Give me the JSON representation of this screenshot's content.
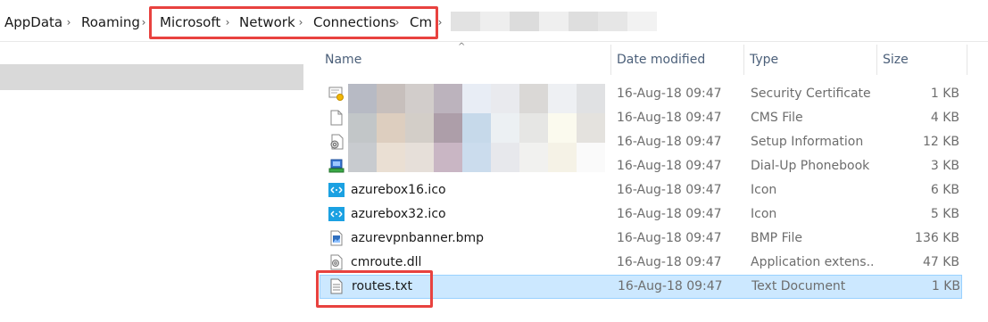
{
  "breadcrumb": {
    "items": [
      "AppData",
      "Roaming",
      "Microsoft",
      "Network",
      "Connections",
      "Cm"
    ]
  },
  "columns": {
    "name": "Name",
    "date": "Date modified",
    "type": "Type",
    "size": "Size"
  },
  "files": [
    {
      "name": "",
      "date": "16-Aug-18 09:47",
      "type": "Security Certificate",
      "size": "1 KB",
      "icon": "certificate-icon"
    },
    {
      "name": "",
      "date": "16-Aug-18 09:47",
      "type": "CMS File",
      "size": "4 KB",
      "icon": "blank-file-icon"
    },
    {
      "name": "",
      "date": "16-Aug-18 09:47",
      "type": "Setup Information",
      "size": "12 KB",
      "icon": "setup-info-icon"
    },
    {
      "name": "",
      "date": "16-Aug-18 09:47",
      "type": "Dial-Up Phonebook",
      "size": "3 KB",
      "icon": "phonebook-icon"
    },
    {
      "name": "azurebox16.ico",
      "date": "16-Aug-18 09:47",
      "type": "Icon",
      "size": "6 KB",
      "icon": "azure-ico-icon"
    },
    {
      "name": "azurebox32.ico",
      "date": "16-Aug-18 09:47",
      "type": "Icon",
      "size": "5 KB",
      "icon": "azure-ico-icon"
    },
    {
      "name": "azurevpnbanner.bmp",
      "date": "16-Aug-18 09:47",
      "type": "BMP File",
      "size": "136 KB",
      "icon": "bitmap-icon"
    },
    {
      "name": "cmroute.dll",
      "date": "16-Aug-18 09:47",
      "type": "Application extens...",
      "size": "47 KB",
      "icon": "dll-icon"
    },
    {
      "name": "routes.txt",
      "date": "16-Aug-18 09:47",
      "type": "Text Document",
      "size": "1 KB",
      "icon": "text-file-icon"
    }
  ],
  "colors": {
    "highlight_box": "#e8423f",
    "selection_bg": "#cce8ff",
    "selection_border": "#99d1ff"
  }
}
